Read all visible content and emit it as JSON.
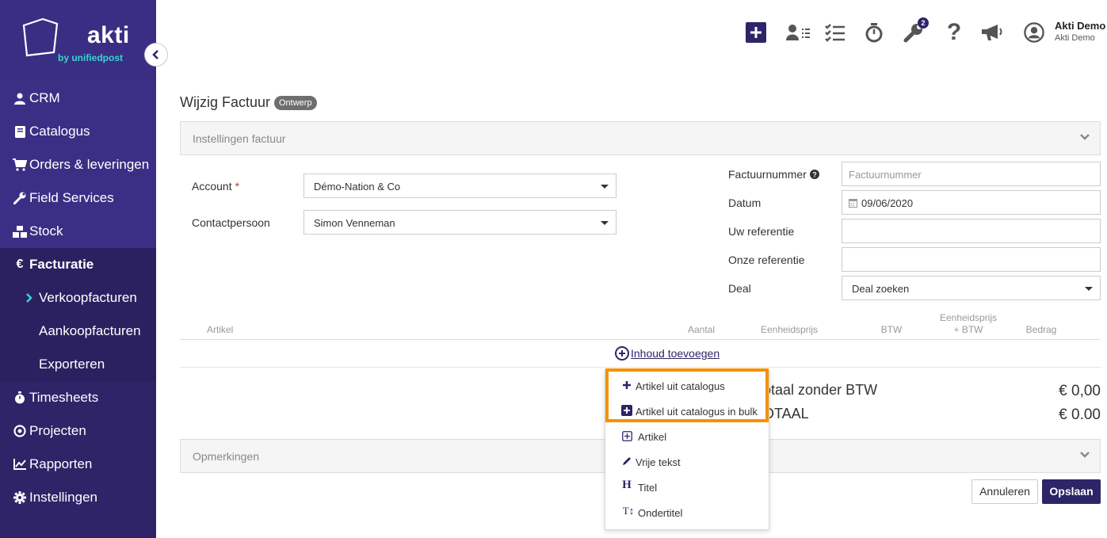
{
  "brand": {
    "logo": "akti",
    "tagline": "by unifiedpost",
    "accent": "#3a2e84",
    "teal": "#3ad3d0",
    "highlight": "#f39200"
  },
  "sidebar": {
    "items": [
      {
        "label": "CRM",
        "icon": "user-icon"
      },
      {
        "label": "Catalogus",
        "icon": "book-icon"
      },
      {
        "label": "Orders & leveringen",
        "icon": "cart-icon"
      },
      {
        "label": "Field Services",
        "icon": "wrench-icon"
      },
      {
        "label": "Stock",
        "icon": "boxes-icon"
      },
      {
        "label": "Facturatie",
        "icon": "euro-icon",
        "active": true
      },
      {
        "label": "Verkoopfacturen",
        "icon": "chevron-right-icon",
        "sub": true,
        "active": true
      },
      {
        "label": "Aankoopfacturen",
        "sub": true
      },
      {
        "label": "Exporteren",
        "sub": true
      },
      {
        "label": "Timesheets",
        "icon": "stopwatch-icon"
      },
      {
        "label": "Projecten",
        "icon": "target-icon"
      },
      {
        "label": "Rapporten",
        "icon": "chart-icon"
      },
      {
        "label": "Instellingen",
        "icon": "gear-icon"
      }
    ]
  },
  "topbar": {
    "notification_count": "2",
    "user_name": "Akti Demo",
    "user_company": "Akti Demo"
  },
  "page": {
    "title": "Wijzig Factuur",
    "status": "Ontwerp"
  },
  "settings_panel": {
    "title": "Instellingen factuur"
  },
  "form": {
    "account_label": "Account",
    "account_required": "*",
    "account_value": "Démo-Nation & Co",
    "contact_label": "Contactpersoon",
    "contact_value": "Simon Venneman",
    "invoice_number_label": "Factuurnummer",
    "invoice_number_placeholder": "Factuurnummer",
    "date_label": "Datum",
    "date_value": "09/06/2020",
    "your_ref_label": "Uw referentie",
    "our_ref_label": "Onze referentie",
    "deal_label": "Deal",
    "deal_value": "Deal zoeken"
  },
  "table": {
    "headers": [
      "Artikel",
      "Aantal",
      "Eenheidsprijs",
      "BTW",
      "Eenheidsprijs",
      "+ BTW",
      "Bedrag"
    ],
    "add_content": "Inhoud toevoegen"
  },
  "totals": {
    "subtotal_label": "otaal zonder BTW",
    "subtotal_value": "€ 0,00",
    "total_label": "OTAAL",
    "total_value": "€ 0.00"
  },
  "remarks_panel": {
    "title": "Opmerkingen"
  },
  "menu": {
    "items": [
      {
        "label": "Artikel uit catalogus",
        "icon": "plus-icon"
      },
      {
        "label": "Artikel uit catalogus in bulk",
        "icon": "plus-square-icon"
      },
      {
        "label": "Artikel",
        "icon": "plus-box-icon"
      },
      {
        "label": "Vrije tekst",
        "icon": "pencil-icon"
      },
      {
        "label": "Titel",
        "icon": "heading-icon",
        "glyph": "H"
      },
      {
        "label": "Ondertitel",
        "icon": "text-height-icon",
        "glyph": "T↕"
      }
    ]
  },
  "buttons": {
    "cancel": "Annuleren",
    "save": "Opslaan"
  }
}
